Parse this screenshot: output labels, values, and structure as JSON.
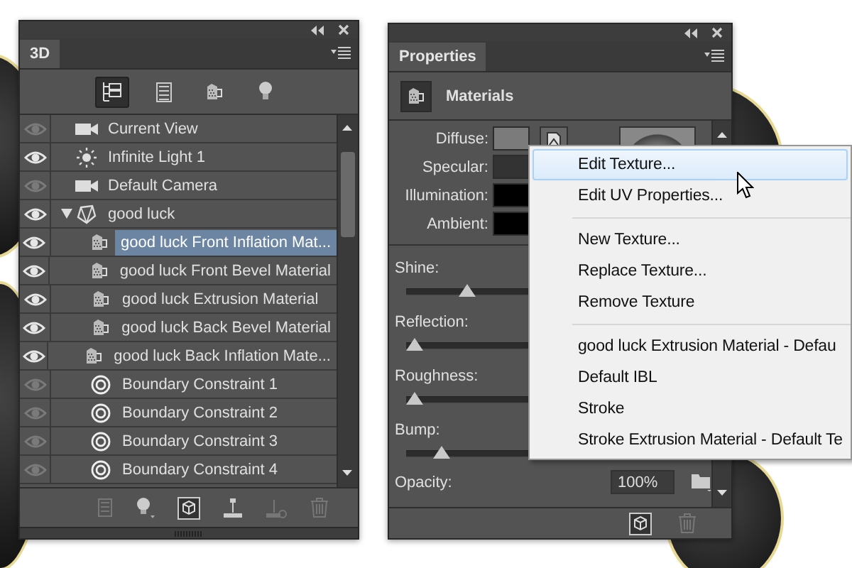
{
  "scene_panel": {
    "tab": "3D",
    "filters": [
      {
        "kind": "scene",
        "selected": true
      },
      {
        "kind": "mesh",
        "selected": false
      },
      {
        "kind": "material",
        "selected": false
      },
      {
        "kind": "light",
        "selected": false
      }
    ],
    "layers": [
      {
        "name": "Current View",
        "kind": "camera",
        "visible": false,
        "selected": false
      },
      {
        "name": "Infinite Light 1",
        "kind": "light",
        "visible": true,
        "selected": false
      },
      {
        "name": "Default Camera",
        "kind": "camera",
        "visible": false,
        "selected": false
      },
      {
        "name": "good luck",
        "kind": "mesh",
        "visible": true,
        "selected": false,
        "expanded": true,
        "children": [
          {
            "name": "good luck Front Inflation Mat...",
            "kind": "material",
            "visible": true,
            "selected": true
          },
          {
            "name": "good luck Front Bevel Material",
            "kind": "material",
            "visible": true,
            "selected": false
          },
          {
            "name": "good luck Extrusion Material",
            "kind": "material",
            "visible": true,
            "selected": false
          },
          {
            "name": "good luck Back Bevel Material",
            "kind": "material",
            "visible": true,
            "selected": false
          },
          {
            "name": "good luck Back Inflation Mate...",
            "kind": "material",
            "visible": true,
            "selected": false
          },
          {
            "name": "Boundary Constraint 1",
            "kind": "constraint",
            "visible": false,
            "selected": false
          },
          {
            "name": "Boundary Constraint 2",
            "kind": "constraint",
            "visible": false,
            "selected": false
          },
          {
            "name": "Boundary Constraint 3",
            "kind": "constraint",
            "visible": false,
            "selected": false
          },
          {
            "name": "Boundary Constraint 4",
            "kind": "constraint",
            "visible": false,
            "selected": false
          }
        ]
      }
    ]
  },
  "properties_panel": {
    "tab": "Properties",
    "header": "Materials",
    "swatches": [
      {
        "label": "Diffuse:",
        "color": "#7b7b7b"
      },
      {
        "label": "Specular:",
        "color": "#333333"
      },
      {
        "label": "Illumination:",
        "color": "#000000"
      },
      {
        "label": "Ambient:",
        "color": "#000000"
      }
    ],
    "sliders": [
      {
        "label": "Shine:",
        "level": 0.2
      },
      {
        "label": "Reflection:",
        "level": 0
      },
      {
        "label": "Roughness:",
        "level": 0
      },
      {
        "label": "Bump:",
        "level": 0.1
      }
    ],
    "opacity": {
      "label": "Opacity:",
      "value": "100%"
    }
  },
  "context_menu": {
    "groups": [
      [
        {
          "label": "Edit Texture...",
          "selected": true
        },
        {
          "label": "Edit UV Properties...",
          "selected": false
        }
      ],
      [
        {
          "label": "New Texture...",
          "selected": false
        },
        {
          "label": "Replace Texture...",
          "selected": false
        },
        {
          "label": "Remove Texture",
          "selected": false
        }
      ],
      [
        {
          "label": "good luck Extrusion Material - Defau",
          "selected": false
        },
        {
          "label": "Default IBL",
          "selected": false
        },
        {
          "label": "Stroke",
          "selected": false
        },
        {
          "label": "Stroke Extrusion Material - Default Te",
          "selected": false
        }
      ]
    ]
  }
}
